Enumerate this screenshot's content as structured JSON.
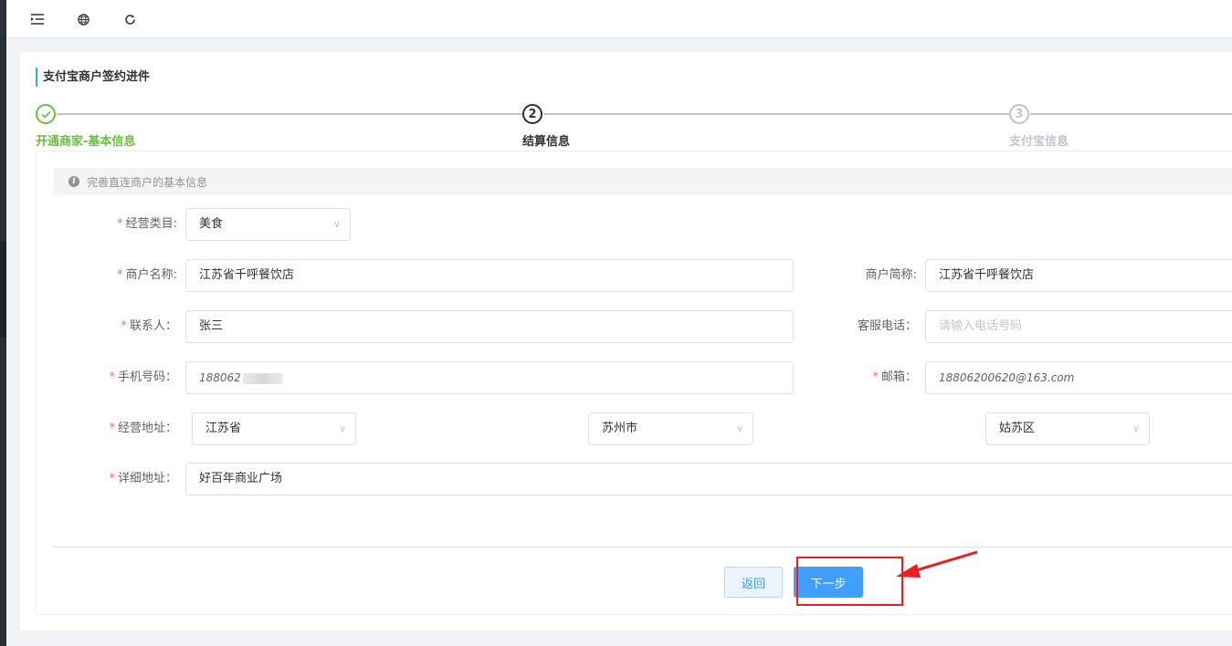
{
  "topbar": {
    "icons": [
      "menu-fold-icon",
      "globe-icon",
      "refresh-icon"
    ]
  },
  "page": {
    "title": "支付宝商户签约进件"
  },
  "steps": [
    {
      "index": "✓",
      "title": "开通商家-基本信息",
      "status": "done"
    },
    {
      "index": "2",
      "title": "结算信息",
      "status": "active"
    },
    {
      "index": "3",
      "title": "支付宝信息",
      "status": "wait"
    }
  ],
  "alert": {
    "icon": "info-icon",
    "text": "完善直连商户的基本信息"
  },
  "form": {
    "category": {
      "label": "经营类目:",
      "value": "美食",
      "required": true
    },
    "merchant_name": {
      "label": "商户名称:",
      "value": "江苏省千呼餐饮店",
      "required": true
    },
    "merchant_short": {
      "label": "商户简称:",
      "value": "江苏省千呼餐饮店",
      "required": false
    },
    "contact": {
      "label": "联系人：",
      "value": "张三",
      "required": true
    },
    "service_phone": {
      "label": "客服电话：",
      "placeholder": "请输入电话号码",
      "required": false
    },
    "mobile": {
      "label": "手机号码：",
      "value": "188062",
      "required": true
    },
    "email": {
      "label": "邮箱：",
      "value": "18806200620@163.com",
      "required": true
    },
    "address": {
      "label": "经营地址：",
      "province": "江苏省",
      "city": "苏州市",
      "district": "姑苏区",
      "required": true
    },
    "detail_address": {
      "label": "详细地址：",
      "value": "好百年商业广场",
      "required": true
    }
  },
  "actions": {
    "back_label": "返回",
    "next_label": "下一步"
  },
  "colors": {
    "primary": "#409eff",
    "success": "#67c23a",
    "required": "#f56c6c",
    "annotation": "#ee1c1c"
  }
}
